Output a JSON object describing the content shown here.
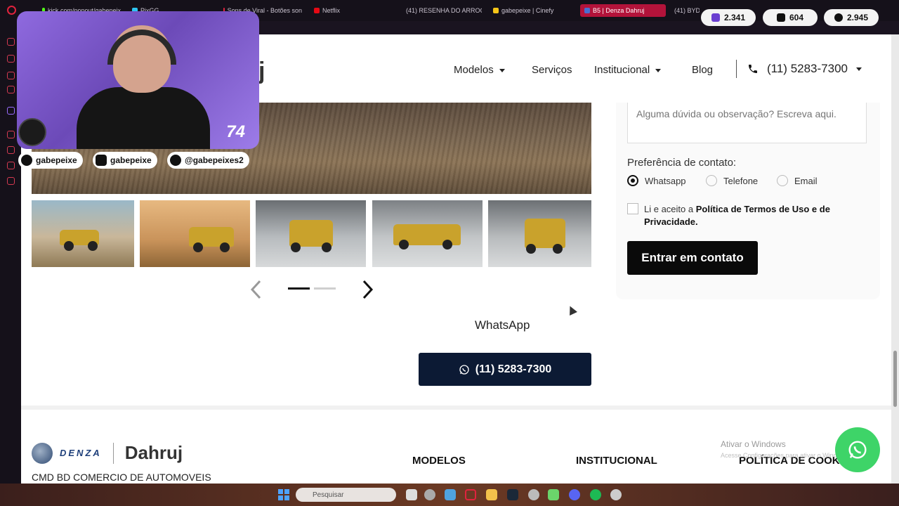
{
  "browser": {
    "tabs": [
      {
        "label": "kick.com/popout/gabepeix",
        "color": "#53fc18"
      },
      {
        "label": "PixGG",
        "color": "#2ec4f0"
      },
      {
        "label": "Sons de Viral - Botões son",
        "color": "#e0233d"
      },
      {
        "label": "Netflix",
        "color": "#e50914"
      },
      {
        "label": "(41) RESENHA DO ARROCÃ",
        "color": "#ff0000"
      },
      {
        "label": "gabepeixe | Cinefy",
        "color": "#f5c518"
      },
      {
        "label": "B5 | Denza Dahruj",
        "color": "#4a6fd1",
        "active": true
      },
      {
        "label": "(41) BYD",
        "color": "#ff0000"
      }
    ]
  },
  "stats": {
    "viewers_twitch": "2.341",
    "viewers_kick": "604",
    "viewers_total": "2.945"
  },
  "overlay": {
    "socials": [
      "gabepeixe",
      "gabepeixe",
      "@gabepeixes2"
    ],
    "jersey_number": "74"
  },
  "header": {
    "logo_fragment": "j",
    "nav": [
      {
        "label": "Modelos",
        "dropdown": true
      },
      {
        "label": "Serviços",
        "dropdown": false
      },
      {
        "label": "Institucional",
        "dropdown": true
      },
      {
        "label": "Blog",
        "dropdown": false
      }
    ],
    "phone": "(11) 5283-7300"
  },
  "gallery": {
    "thumbnails": [
      "front-three-quarter",
      "offroad-dust",
      "front",
      "side",
      "rear"
    ],
    "active_slide": 1,
    "total_slides": 2
  },
  "whatsapp": {
    "label": "WhatsApp",
    "button_label": "(11) 5283-7300"
  },
  "form": {
    "message_placeholder": "Alguma dúvida ou observação? Escreva aqui.",
    "preference_label": "Preferência de contato:",
    "options": [
      "Whatsapp",
      "Telefone",
      "Email"
    ],
    "selected_option": "Whatsapp",
    "terms_prefix": "Li e aceito a ",
    "terms_link": "Política de Termos de Uso e de Privacidade.",
    "submit_label": "Entrar em contato"
  },
  "footer": {
    "brand_left": "DENZA",
    "brand_right": "Dahruj",
    "company": "CMD BD COMERCIO DE AUTOMOVEIS",
    "columns": [
      "MODELOS",
      "INSTITUCIONAL",
      "POLÍTICA DE COOKI"
    ]
  },
  "windows": {
    "activate_title": "Ativar o Windows",
    "activate_sub": "Acesse Configurações para ativar o Windows.",
    "search_placeholder": "Pesquisar"
  },
  "colors": {
    "accent_navy": "#0c1a34",
    "whatsapp_green": "#3ed468",
    "opera_red": "#e0233d"
  }
}
